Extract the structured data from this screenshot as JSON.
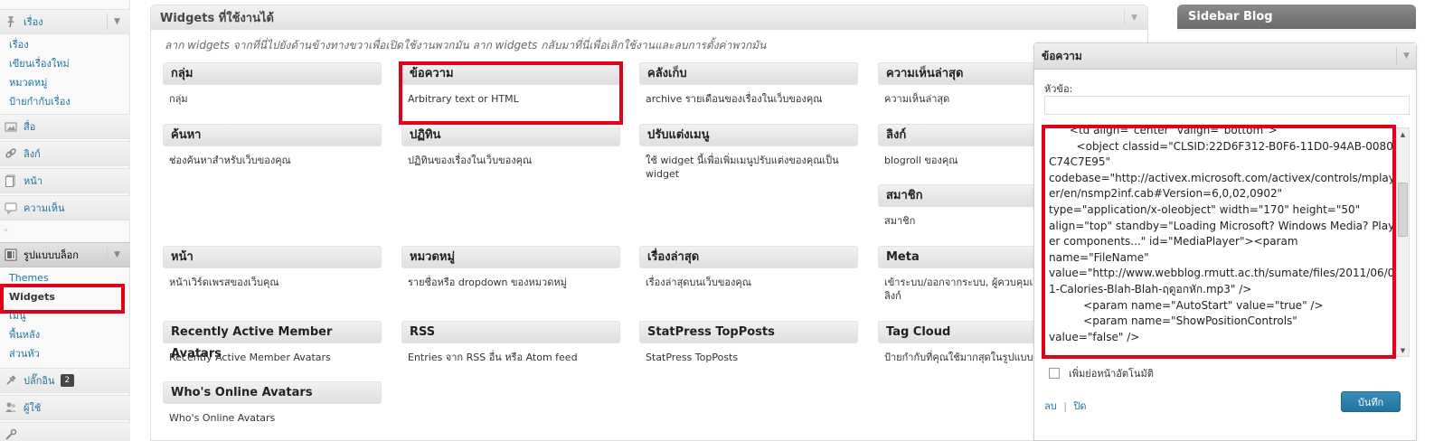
{
  "menu": {
    "posts": {
      "label": "เรื่อง",
      "icon": "pushpin-icon"
    },
    "posts_sub": [
      "เรื่อง",
      "เขียนเรื่องใหม่",
      "หมวดหมู่",
      "ป้ายกำกับเรื่อง"
    ],
    "media": {
      "label": "สื่อ",
      "icon": "media-icon"
    },
    "links": {
      "label": "ลิงก์",
      "icon": "link-icon"
    },
    "pages": {
      "label": "หน้า",
      "icon": "page-icon"
    },
    "comments": {
      "label": "ความเห็น",
      "icon": "comment-icon"
    },
    "appearance": {
      "label": "รูปแบบบล็อก",
      "icon": "appearance-icon"
    },
    "appearance_sub": [
      "Themes",
      "Widgets",
      "เมนู",
      "พื้นหลัง",
      "ส่วนหัว"
    ],
    "plugins": {
      "label": "ปลั๊กอิน",
      "badge": "2",
      "icon": "plugin-icon"
    },
    "users": {
      "label": "ผู้ใช้",
      "icon": "users-icon"
    }
  },
  "available": {
    "title": "Widgets ที่ใช้งานได้",
    "description": "ลาก widgets จากที่นี่ไปยังด้านข้างทางขวาเพื่อเปิดใช้งานพวกมัน ลาก widgets กลับมาที่นี่เพื่อเลิกใช้งานและลบการตั้งค่าพวกมัน",
    "widgets": [
      {
        "title": "กลุ่ม",
        "desc": "กลุ่ม"
      },
      {
        "title": "ข้อความ",
        "desc": "Arbitrary text or HTML"
      },
      {
        "title": "คลังเก็บ",
        "desc": "archive รายเดือนของเรื่องในเว็บของคุณ"
      },
      {
        "title": "ความเห็นล่าสุด",
        "desc": "ความเห็นล่าสุด"
      },
      {
        "title": "ค้นหา",
        "desc": "ช่องค้นหาสำหรับเว็บของคุณ"
      },
      {
        "title": "ปฏิทิน",
        "desc": "ปฏิทินของเรื่องในเว็บของคุณ"
      },
      {
        "title": "ปรับแต่งเมนู",
        "desc": "ใช้ widget นี้เพื่อเพิ่มเมนูปรับแต่งของคุณเป็น widget"
      },
      {
        "title": "ลิงก์",
        "desc": "blogroll ของคุณ"
      },
      {
        "title": "สมาชิก",
        "desc": "สมาชิก"
      },
      {
        "title": "หน้า",
        "desc": "หน้าเวิร์ดเพรสของเว็บคุณ"
      },
      {
        "title": "หมวดหมู่",
        "desc": "รายชื่อหรือ dropdown ของหมวดหมู่"
      },
      {
        "title": "เรื่องล่าสุด",
        "desc": "เรื่องล่าสุดบนเว็บของคุณ"
      },
      {
        "title": "Meta",
        "desc": "เข้าระบบ/ออกจากระบบ, ผู้ควบคุมเว็บ, เวิร์ดเพรสลิงก์"
      },
      {
        "title": "Recently Active Member Avatars",
        "desc": "Recently Active Member Avatars"
      },
      {
        "title": "RSS",
        "desc": "Entries จาก RSS อื่น หรือ Atom feed"
      },
      {
        "title": "StatPress TopPosts",
        "desc": "StatPress TopPosts"
      },
      {
        "title": "Tag Cloud",
        "desc": "ป้ายกำกับที่คุณใช้มากสุดในรูปแบบของ"
      },
      {
        "title": "Who's Online Avatars",
        "desc": "Who's Online Avatars"
      }
    ]
  },
  "sidebar": {
    "title": "Sidebar Blog"
  },
  "editor": {
    "title": "ข้อความ",
    "field_label": "หัวข้อ:",
    "title_value": "",
    "code_text": "      <td align=\"center\" valign=\"bottom\">\n        <object classid=\"CLSID:22D6F312-B0F6-11D0-94AB-0080C74C7E95\"\ncodebase=\"http://activex.microsoft.com/activex/controls/mplayer/en/nsmp2inf.cab#Version=6,0,02,0902\"\ntype=\"application/x-oleobject\" width=\"170\" height=\"50\"\nalign=\"top\" standby=\"Loading Microsoft? Windows Media? Player components...\" id=\"MediaPlayer\"><param\nname=\"FileName\"\nvalue=\"http://www.webblog.rmutt.ac.th/sumate/files/2011/06/01-Calories-Blah-Blah-ฤดูอกหัก.mp3\" />\n          <param name=\"AutoStart\" value=\"true\" />\n          <param name=\"ShowPositionControls\"\nvalue=\"false\" />",
    "auto_paragraph": "เพิ่มย่อหน้าอัตโนมัติ",
    "delete": "ลบ",
    "separator": "|",
    "close": "ปิด",
    "save": "บันทึก"
  }
}
